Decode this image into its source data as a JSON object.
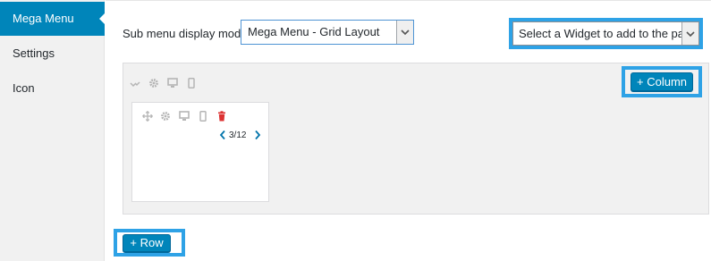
{
  "sidebar": {
    "items": [
      {
        "label": "Mega Menu",
        "active": true
      },
      {
        "label": "Settings",
        "active": false
      },
      {
        "label": "Icon",
        "active": false
      }
    ]
  },
  "submenu_mode": {
    "label": "Sub menu display mode",
    "selected": "Mega Menu - Grid Layout"
  },
  "widget_selector": {
    "selected": "Select a Widget to add to the panel"
  },
  "row_toolbar": {
    "icons": [
      "collapse-icon",
      "gear-icon",
      "desktop-icon",
      "mobile-icon"
    ]
  },
  "column": {
    "icons": [
      "move-icon",
      "gear-icon",
      "desktop-icon",
      "mobile-icon",
      "trash-icon"
    ],
    "width_value": "3/12"
  },
  "buttons": {
    "add_column": "+ Column",
    "add_row": "+ Row"
  },
  "colors": {
    "accent": "#0085ba",
    "highlight": "#2ea2e6",
    "delete": "#dc3232"
  }
}
